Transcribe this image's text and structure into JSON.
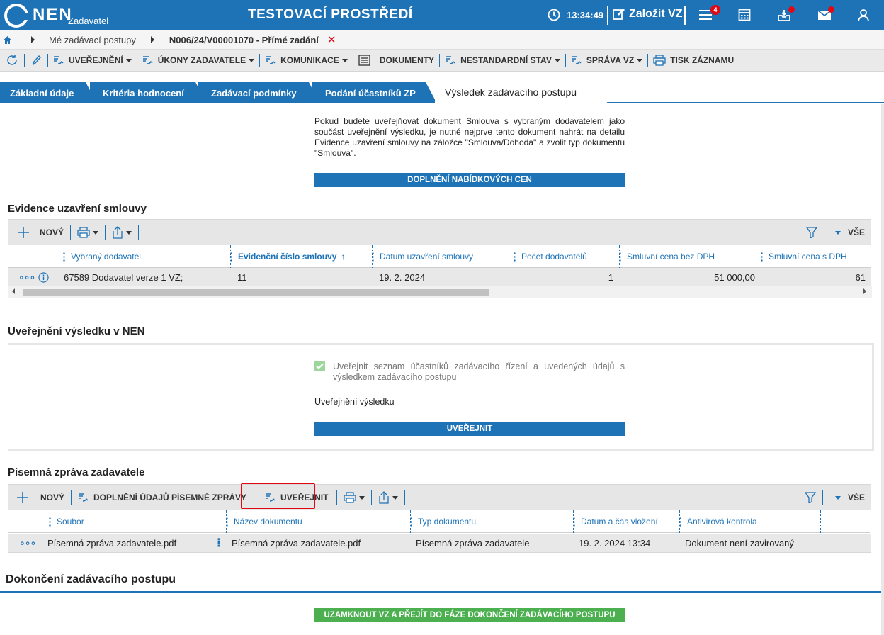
{
  "topbar": {
    "logo_text": "NEN",
    "logo_sub": "Zadavatel",
    "env_title": "TESTOVACÍ PROSTŘEDÍ",
    "clock": "13:34:49",
    "create_label": "Založit VZ",
    "notif_count": "4",
    "accent": "#1e73b7"
  },
  "breadcrumb": {
    "items": [
      "Mé zadávací postupy",
      "N006/24/V00001070 - Přímé zadání"
    ]
  },
  "menu": {
    "items": [
      "UVEŘEJNĚNÍ",
      "ÚKONY ZADAVATELE",
      "KOMUNIKACE",
      "DOKUMENTY",
      "NESTANDARDNÍ STAV",
      "SPRÁVA VZ",
      "TISK ZÁZNAMU"
    ]
  },
  "tabs": [
    "Základní údaje",
    "Kritéria hodnocení",
    "Zadávací podmínky",
    "Podání účastníků ZP",
    "Výsledek zadávacího postupu"
  ],
  "info": {
    "text": "Pokud budete uveřejňovat dokument Smlouva s vybraným dodavatelem jako součást uveřejnění výsledku, je nutné nejprve tento dokument nahrát na detailu Evidence uzavření smlouvy na záložce \"Smlouva/Dohoda\" a zvolit typ dokumentu \"Smlouva\".",
    "button": "DOPLNĚNÍ NABÍDKOVÝCH CEN"
  },
  "contracts": {
    "title": "Evidence uzavření smlouvy",
    "new_label": "NOVÝ",
    "all_label": "VŠE",
    "columns": [
      "Vybraný dodavatel",
      "Evidenční číslo smlouvy",
      "Datum uzavření smlouvy",
      "Počet dodavatelů",
      "Smluvní cena bez DPH",
      "Smluvní cena s DPH"
    ],
    "sort_arrow": "↑",
    "rows": [
      {
        "supplier": "67589 Dodavatel verze 1 VZ;",
        "number": "11",
        "date": "19. 2. 2024",
        "count": "1",
        "price": "51 000,00",
        "price_vat": "61"
      }
    ]
  },
  "publication": {
    "title": "Uveřejnění výsledku v NEN",
    "checkbox_label": "Uveřejnit seznam účastníků zadávacího řízení a uvedených údajů s výsledkem zadávacího postupu",
    "checked": true,
    "field_label": "Uveřejnění výsledku",
    "button": "UVEŘEJNIT"
  },
  "report": {
    "title": "Písemná zpráva zadavatele",
    "new_label": "NOVÝ",
    "extra_label": "DOPLNĚNÍ ÚDAJŮ PÍSEMNÉ ZPRÁVY",
    "publish_label": "UVEŘEJNIT",
    "all_label": "VŠE",
    "columns": [
      "Soubor",
      "Název dokumentu",
      "Typ dokumentu",
      "Datum a čas vložení",
      "Antivirová kontrola"
    ],
    "rows": [
      {
        "file": "Písemná zpráva zadavatele.pdf",
        "name": "Písemná zpráva zadavatele.pdf",
        "type": "Písemná zpráva zadavatele",
        "datetime": "19. 2. 2024 13:34",
        "antivirus": "Dokument není zavirovaný"
      }
    ]
  },
  "final": {
    "title": "Dokončení zadávacího postupu",
    "button": "UZAMKNOUT VZ A PŘEJÍT DO FÁZE DOKONČENÍ ZADÁVACÍHO POSTUPU"
  }
}
